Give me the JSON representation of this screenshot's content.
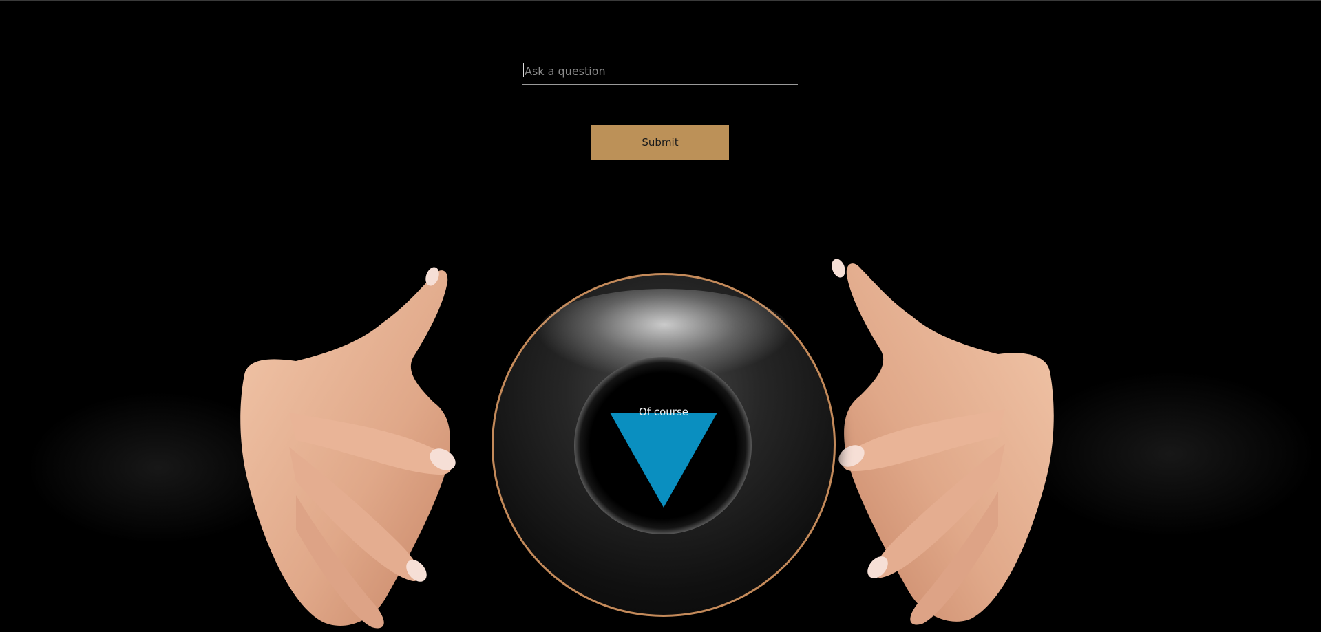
{
  "form": {
    "question_placeholder": "Ask a question",
    "question_value": "",
    "submit_label": "Submit"
  },
  "eight_ball": {
    "answer": "Of course",
    "triangle_color": "#0a8fc0",
    "glow_color": "#ee8214"
  },
  "colors": {
    "background": "#000000",
    "button": "#bc9158",
    "skin": "#e8b89a"
  },
  "icons": {
    "answer_die": "triangle-die-icon"
  }
}
